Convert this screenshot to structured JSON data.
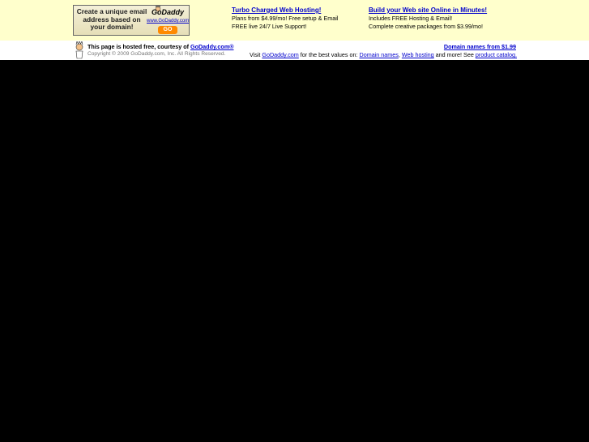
{
  "banner": {
    "headline": "Create a unique email address based on your domain!",
    "logo_text": "GoDaddy",
    "url_text": "www.GoDaddy.com",
    "go_label": "GO"
  },
  "promo1": {
    "title": "Turbo Charged Web Hosting!",
    "line1": "Plans from $4.99/mo! Free setup & Email",
    "line2": "FREE live 24/7 Live Support!"
  },
  "promo2": {
    "title": "Build your Web site Online in Minutes!",
    "line1": "Includes FREE Hosting & Email!",
    "line2": "Complete creative packages from $3.99/mo!"
  },
  "footer": {
    "hosted_prefix": "This page is hosted free, courtesy of ",
    "hosted_link": "GoDaddy.com®",
    "copyright": "Copyright © 2009 GoDaddy.com, Inc. All Rights Reserved.",
    "domain_link": "Domain names from $1.99",
    "visit_prefix": "Visit ",
    "visit_link": "GoDaddy.com",
    "visit_mid": " for the best values on: ",
    "domain_names_link": "Domain names",
    "comma": ", ",
    "web_hosting_link": "Web hosting",
    "visit_suffix": " and more! See ",
    "catalog_link": "product catalog."
  },
  "colors": {
    "top_bar_bg": "#ffffcc",
    "link": "#0000cc",
    "page_bg": "#000000"
  }
}
